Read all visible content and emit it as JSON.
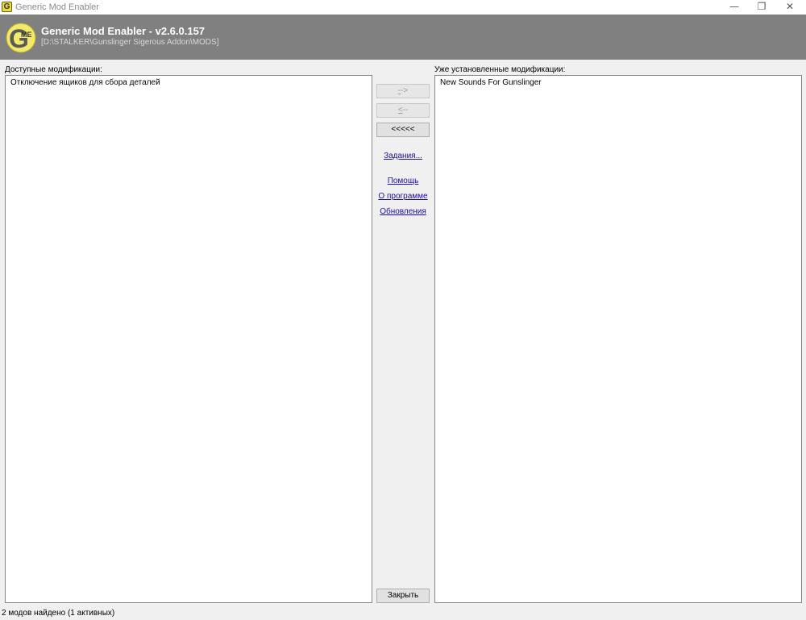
{
  "window": {
    "title": "Generic Mod Enabler",
    "icon_letter": "G",
    "controls": {
      "minimize": "—",
      "restore": "❐",
      "close": "✕"
    }
  },
  "header": {
    "logo_letter": "G",
    "logo_text": "ME",
    "app_name": "Generic Mod Enabler - v2.6.0.157",
    "mods_path": "[D:\\STALKER\\Gunslinger Sigerous Addon\\MODS]"
  },
  "available": {
    "label": "Доступные модификации:",
    "items": [
      "Отключение ящиков для сбора деталей"
    ]
  },
  "installed": {
    "label": "Уже установленные модификации:",
    "items": [
      "New Sounds For Gunslinger"
    ]
  },
  "actions": {
    "activate_key": "-",
    "activate_rest": "->",
    "deactivate_key": "<",
    "deactivate_rest": "--",
    "deactivate_all_label": "<<<<<",
    "tasks_link": "Задания...",
    "help_link": "Помощь",
    "about_link": "О программе",
    "updates_link": "Обновления",
    "close_label": "Закрыть"
  },
  "status": {
    "text": "2 модов найдено (1 активных)"
  },
  "colors": {
    "header_bg": "#808080",
    "logo_yellow": "#f2e86a",
    "link": "#1a0dab"
  }
}
